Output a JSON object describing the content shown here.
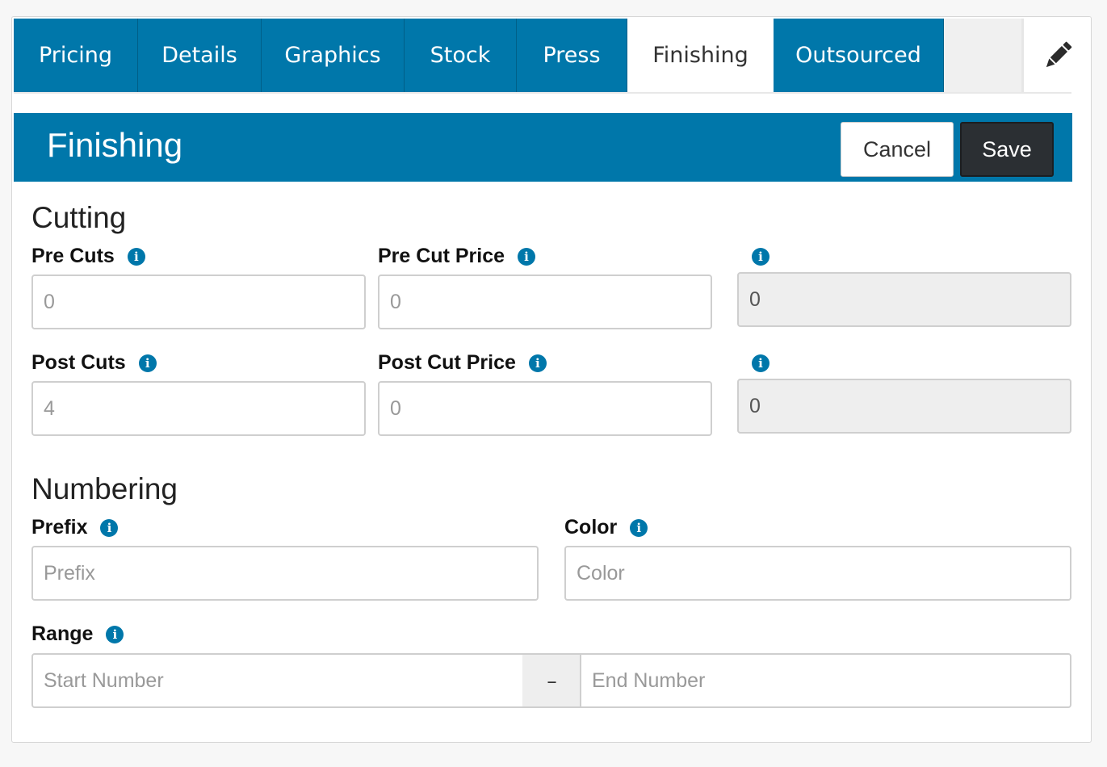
{
  "tabs": [
    {
      "label": "Pricing",
      "active": false
    },
    {
      "label": "Details",
      "active": false
    },
    {
      "label": "Graphics",
      "active": false
    },
    {
      "label": "Stock",
      "active": false
    },
    {
      "label": "Press",
      "active": false
    },
    {
      "label": "Finishing",
      "active": true
    },
    {
      "label": "Outsourced",
      "active": false
    }
  ],
  "edit_icon": "pencil-icon",
  "header": {
    "title": "Finishing",
    "cancel_label": "Cancel",
    "save_label": "Save"
  },
  "cutting": {
    "heading": "Cutting",
    "pre_cuts": {
      "label": "Pre Cuts",
      "value": "",
      "placeholder": "0"
    },
    "pre_cut_price": {
      "label": "Pre Cut Price",
      "value": "",
      "placeholder": "0"
    },
    "pre_total": {
      "value": "0"
    },
    "post_cuts": {
      "label": "Post Cuts",
      "value": "",
      "placeholder": "4"
    },
    "post_cut_price": {
      "label": "Post Cut Price",
      "value": "",
      "placeholder": "0"
    },
    "post_total": {
      "value": "0"
    }
  },
  "numbering": {
    "heading": "Numbering",
    "prefix": {
      "label": "Prefix",
      "placeholder": "Prefix"
    },
    "color": {
      "label": "Color",
      "placeholder": "Color"
    },
    "range": {
      "label": "Range",
      "start_placeholder": "Start Number",
      "separator": "–",
      "end_placeholder": "End Number"
    }
  },
  "colors": {
    "accent": "#0077aa",
    "save_button": "#2b2f33"
  },
  "info_icon": "info-icon"
}
